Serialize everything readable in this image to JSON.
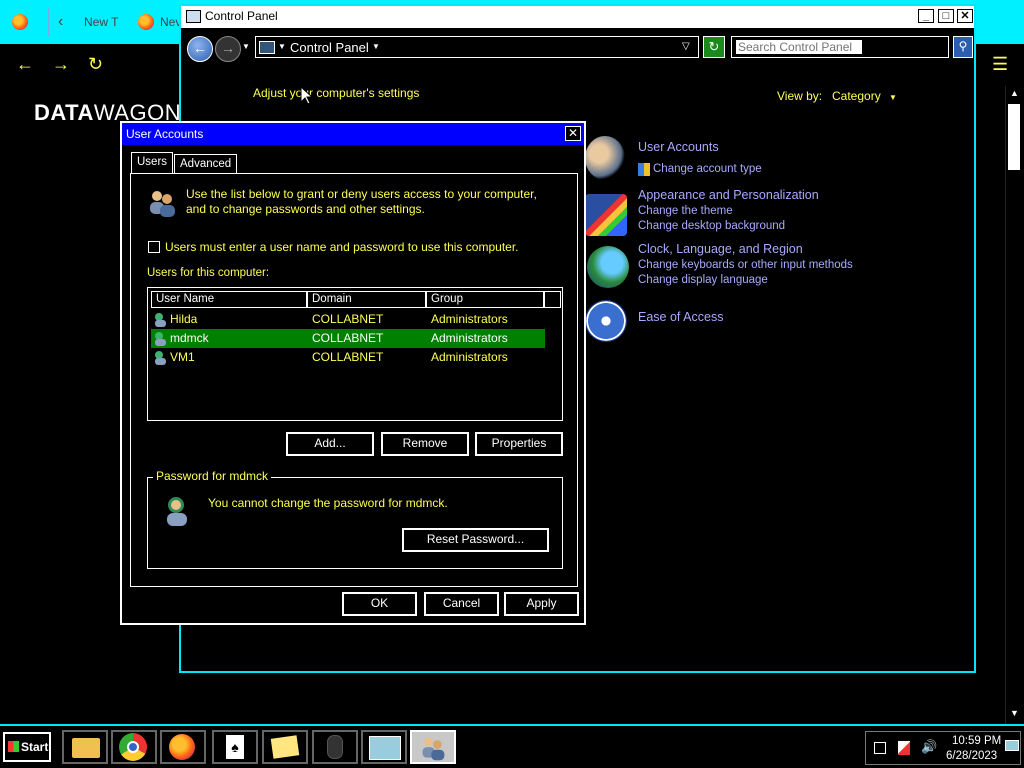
{
  "browser": {
    "tabs": [
      {
        "label": "New T"
      },
      {
        "label": "Nev"
      }
    ],
    "brand_bold": "DATA",
    "brand_rest": "WAGON"
  },
  "control_panel": {
    "title": "Control Panel",
    "address": "Control Panel",
    "search_placeholder": "Search Control Panel",
    "heading": "Adjust your computer's settings",
    "view_by_label": "View by:",
    "view_by_value": "Category",
    "categories": [
      {
        "title": "User Accounts",
        "links": [
          "Change account type"
        ]
      },
      {
        "title": "Appearance and Personalization",
        "links": [
          "Change the theme",
          "Change desktop background"
        ]
      },
      {
        "title": "Clock, Language, and Region",
        "links": [
          "Change keyboards or other input methods",
          "Change display language"
        ]
      },
      {
        "title": "Ease of Access",
        "links": []
      }
    ]
  },
  "user_accounts": {
    "title": "User Accounts",
    "tabs": [
      "Users",
      "Advanced"
    ],
    "intro": "Use the list below to grant or deny users access to your computer, and to change passwords and other settings.",
    "checkbox_label": "Users must enter a user name and password to use this computer.",
    "checkbox_checked": false,
    "users_label": "Users for this computer:",
    "columns": [
      "User Name",
      "Domain",
      "Group"
    ],
    "users": [
      {
        "name": "Hilda",
        "domain": "COLLABNET",
        "group": "Administrators",
        "selected": false
      },
      {
        "name": "mdmck",
        "domain": "COLLABNET",
        "group": "Administrators",
        "selected": true
      },
      {
        "name": "VM1",
        "domain": "COLLABNET",
        "group": "Administrators",
        "selected": false
      }
    ],
    "buttons": {
      "add": "Add...",
      "remove": "Remove",
      "properties": "Properties"
    },
    "password_group": "Password for mdmck",
    "password_text": "You cannot change the password for mdmck.",
    "reset_password": "Reset Password...",
    "ok": "OK",
    "cancel": "Cancel",
    "apply": "Apply"
  },
  "taskbar": {
    "start": "Start",
    "time": "10:59 PM",
    "date": "6/28/2023"
  },
  "colors": {
    "accent_cyan": "#00e8f8",
    "text_yellow": "#ffff55",
    "link_lavender": "#a9a9ff",
    "dialog_title": "#0000ff",
    "selection_green": "#008000"
  }
}
